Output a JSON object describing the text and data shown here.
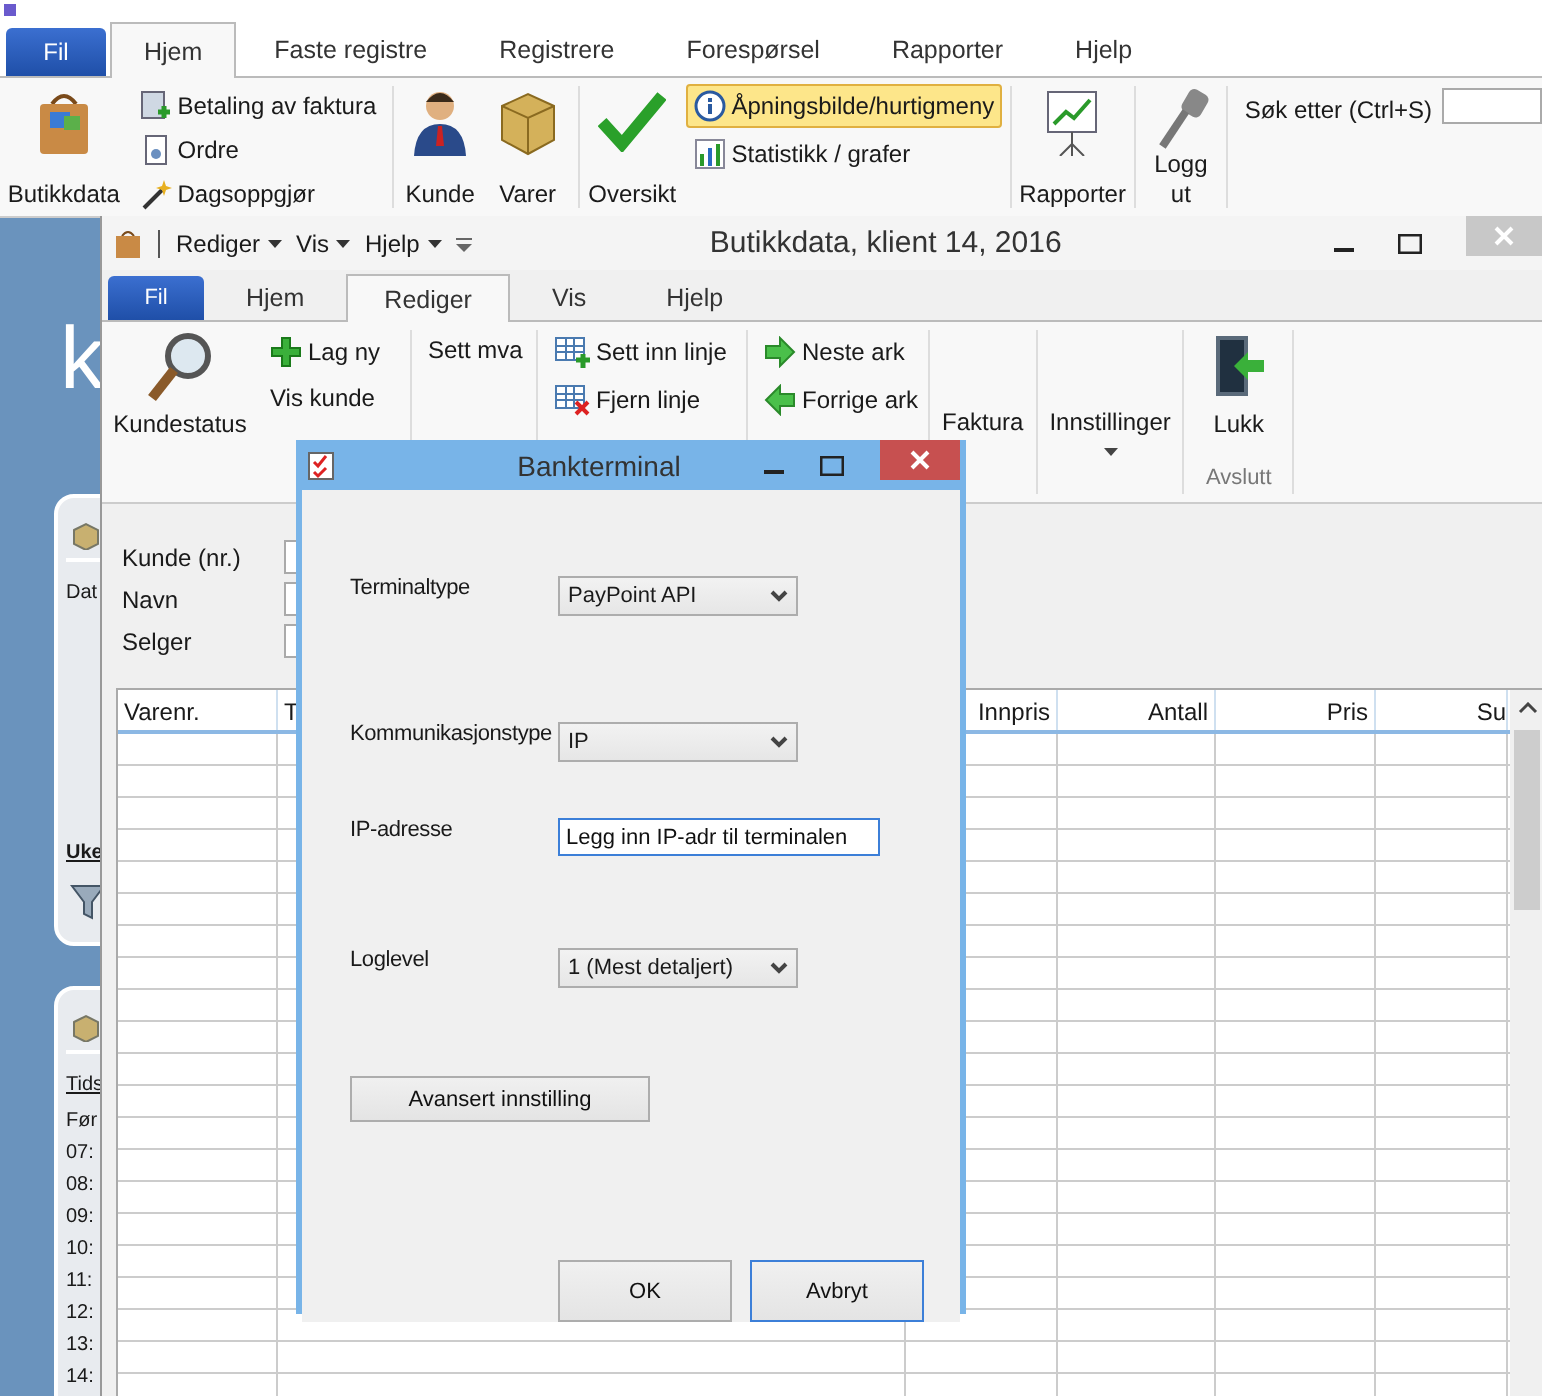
{
  "main_window": {
    "tabs": [
      {
        "label": "Fil",
        "kind": "file",
        "selected": false
      },
      {
        "label": "Hjem",
        "kind": "tab",
        "selected": true
      },
      {
        "label": "Faste registre",
        "kind": "tab",
        "selected": false
      },
      {
        "label": "Registrere",
        "kind": "tab",
        "selected": false
      },
      {
        "label": "Forespørsel",
        "kind": "tab",
        "selected": false
      },
      {
        "label": "Rapporter",
        "kind": "tab",
        "selected": false
      },
      {
        "label": "Hjelp",
        "kind": "tab",
        "selected": false
      }
    ],
    "ribbon": [
      {
        "label": "Butikkdata",
        "highlighted": false
      },
      {
        "label": "Betaling av faktura",
        "highlighted": false
      },
      {
        "label": "Ordre",
        "highlighted": false
      },
      {
        "label": "Dagsoppgjør",
        "highlighted": false
      },
      {
        "label": "Kunde",
        "highlighted": false
      },
      {
        "label": "Varer",
        "highlighted": false
      },
      {
        "label": "Oversikt",
        "highlighted": false
      },
      {
        "label": "Åpningsbilde/hurtigmeny",
        "highlighted": true
      },
      {
        "label": "Statistikk / grafer",
        "highlighted": false
      },
      {
        "label": "Rapporter",
        "highlighted": false
      },
      {
        "label": "Logg ut",
        "highlighted": false
      }
    ],
    "search": {
      "label": "Søk etter (Ctrl+S)"
    }
  },
  "background_panel": {
    "logo_letter": "k",
    "cards": [
      {
        "headings": [
          "Dat",
          "Uke"
        ]
      },
      {
        "headings": [
          "Tids"
        ],
        "rows": [
          "Før",
          "07:",
          "08:",
          "09:",
          "10:",
          "11:",
          "12:",
          "13:",
          "14:"
        ]
      }
    ]
  },
  "document_window": {
    "title": "Butikkdata, klient 14, 2016",
    "quick_menu": [
      "Rediger",
      "Vis",
      "Hjelp"
    ],
    "tabs": [
      {
        "label": "Fil",
        "kind": "file",
        "selected": false
      },
      {
        "label": "Hjem",
        "kind": "tab",
        "selected": false
      },
      {
        "label": "Rediger",
        "kind": "tab",
        "selected": true
      },
      {
        "label": "Vis",
        "kind": "tab",
        "selected": false
      },
      {
        "label": "Hjelp",
        "kind": "tab",
        "selected": false
      }
    ],
    "ribbon": [
      "Kundestatus",
      "Lag ny",
      "Vis kunde",
      "Sett mva",
      "Sett inn linje",
      "Fjern linje",
      "Neste ark",
      "Forrige ark",
      "Faktura",
      "Innstillinger",
      "Lukk"
    ],
    "ribbon_group_label": "Avslutt",
    "form_labels": [
      "Kunde (nr.)",
      "Navn",
      "Selger"
    ],
    "table": {
      "columns": [
        "Varenr.",
        "T",
        "Innpris",
        "Antall",
        "Pris",
        "Su"
      ]
    }
  },
  "dialog": {
    "title": "Bankterminal",
    "fields": [
      {
        "kind": "dropdown",
        "label": "Terminaltype",
        "value": "PayPoint API",
        "focused": false
      },
      {
        "kind": "dropdown",
        "label": "Kommunikasjonstype",
        "value": "IP",
        "focused": false
      },
      {
        "kind": "text",
        "label": "IP-adresse",
        "value": "Legg inn IP-adr til terminalen",
        "focused": true
      },
      {
        "kind": "dropdown",
        "label": "Loglevel",
        "value": "1 (Mest detaljert)",
        "focused": false
      }
    ],
    "advanced_button": "Avansert innstilling",
    "buttons": [
      {
        "label": "OK",
        "focused": false
      },
      {
        "label": "Avbryt",
        "focused": true
      }
    ]
  }
}
